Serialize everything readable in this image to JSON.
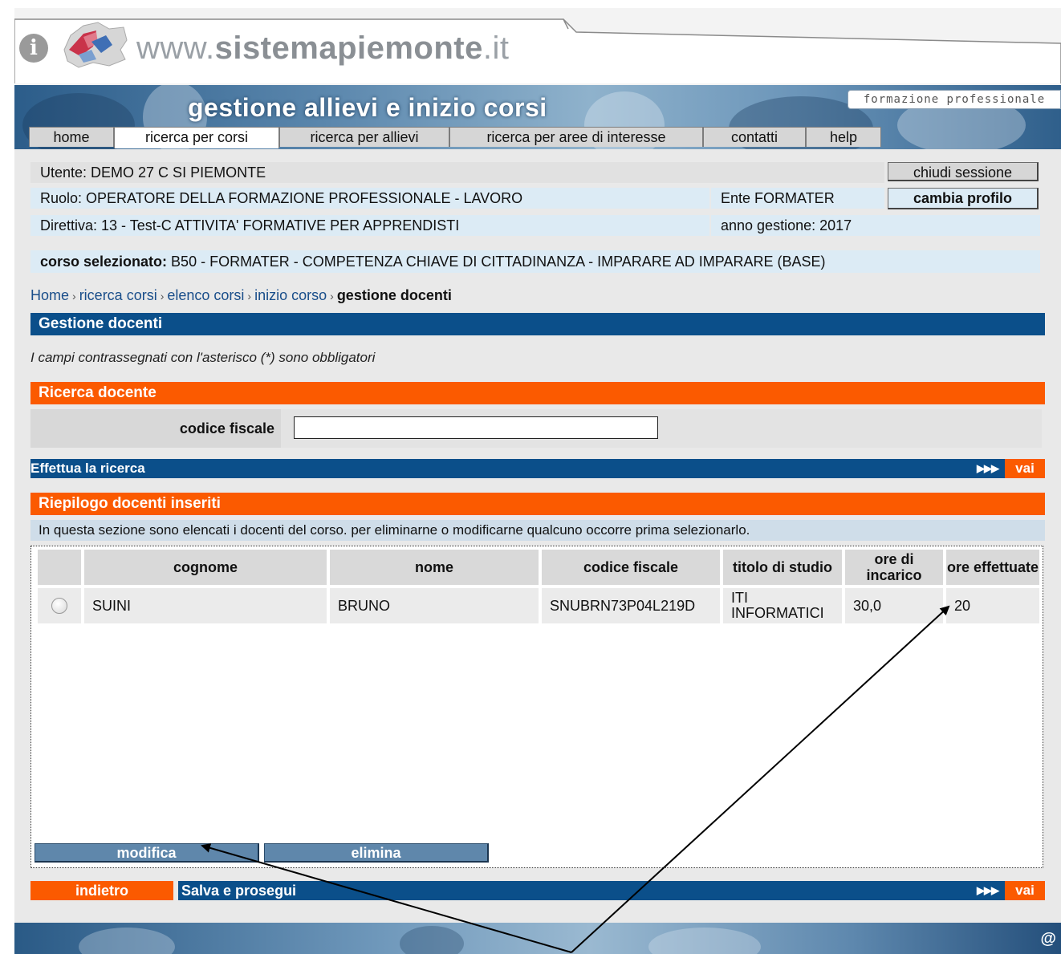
{
  "site": {
    "title_prefix": "www.",
    "title_main": "sistemapiemonte",
    "title_suffix": ".it",
    "info_glyph": "i",
    "region_icon": "piemonte-region-icon"
  },
  "banner": {
    "title": "gestione allievi e inizio corsi",
    "tag": "formazione professionale"
  },
  "nav": {
    "tabs": [
      {
        "label": "home"
      },
      {
        "label": "ricerca per corsi"
      },
      {
        "label": "ricerca per allievi"
      },
      {
        "label": "ricerca per aree di interesse"
      },
      {
        "label": "contatti"
      },
      {
        "label": "help"
      }
    ]
  },
  "user": {
    "utente": "Utente: DEMO 27 C SI PIEMONTE",
    "ruolo": "Ruolo: OPERATORE DELLA FORMAZIONE PROFESSIONALE - LAVORO",
    "ente": "Ente FORMATER",
    "direttiva": "Direttiva: 13 - Test-C ATTIVITA' FORMATIVE PER APPRENDISTI",
    "anno": "anno gestione: 2017",
    "chiudi_label": "chiudi sessione",
    "cambia_label": "cambia profilo"
  },
  "corso": {
    "label": "corso selezionato:",
    "value": " B50 - FORMATER - COMPETENZA CHIAVE DI CITTADINANZA - IMPARARE AD IMPARARE (BASE)"
  },
  "breadcrumb": {
    "items": [
      "Home",
      "ricerca corsi",
      "elenco corsi",
      "inizio corso"
    ],
    "separator": "›",
    "current": "gestione docenti"
  },
  "page_title": "Gestione docenti",
  "note": "I campi contrassegnati con l'asterisco (*) sono obbligatori",
  "ricerca": {
    "title": "Ricerca docente",
    "field_label": "codice fiscale",
    "field_value": "",
    "action_label": "Effettua la ricerca",
    "arrows": "▶▶▶",
    "vai_label": "vai"
  },
  "riepilogo": {
    "title": "Riepilogo docenti inseriti",
    "info": "In questa sezione sono elencati i docenti del corso. per eliminarne o modificarne qualcuno occorre prima selezionarlo.",
    "columns": {
      "cognome": "cognome",
      "nome": "nome",
      "cf": "codice fiscale",
      "titolo": "titolo di studio",
      "ore_incarico": "ore di incarico",
      "ore_effettuate": "ore effettuate"
    },
    "rows": [
      {
        "cognome": "SUINI",
        "nome": "BRUNO",
        "cf": "SNUBRN73P04L219D",
        "titolo": "ITI INFORMATICI",
        "ore_incarico": "30,0",
        "ore_effettuate": "20"
      }
    ],
    "modifica_label": "modifica",
    "elimina_label": "elimina"
  },
  "bottom": {
    "indietro_label": "indietro",
    "salva_label": "Salva e prosegui",
    "arrows": "▶▶▶",
    "vai_label": "vai"
  },
  "footer": {
    "at_glyph": "@"
  },
  "colors": {
    "orange": "#fb5a00",
    "blue": "#0b4f8a",
    "light_blue": "#dcebf5"
  }
}
